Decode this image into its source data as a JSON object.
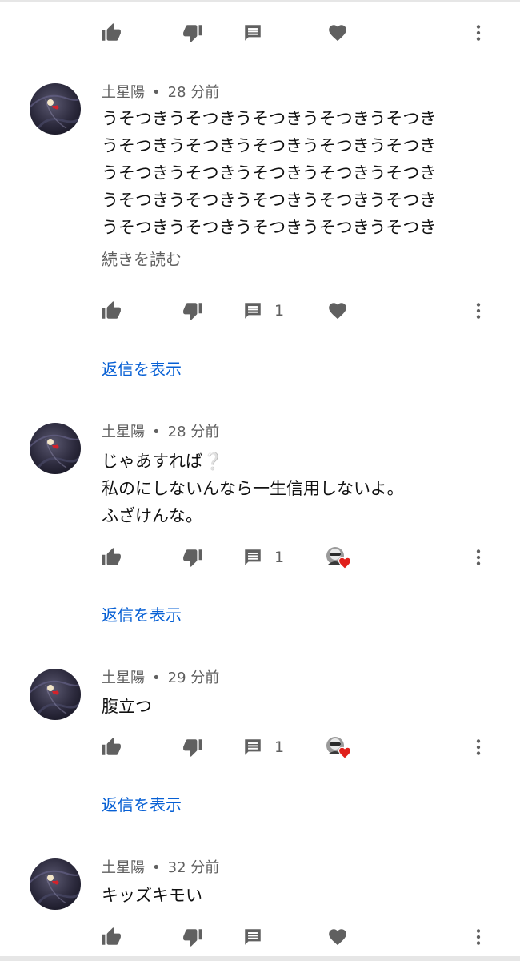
{
  "comments": [
    {
      "author": "土星陽",
      "separator": "•",
      "time": "28 分前",
      "text": "うそつきうそつきうそつきうそつきうそつき\nうそつきうそつきうそつきうそつきうそつき\nうそつきうそつきうそつきうそつきうそつき\nうそつきうそつきうそつきうそつきうそつき\nうそつきうそつきうそつきうそつきうそつき",
      "read_more": "続きを読む",
      "reply_count": "1",
      "view_replies": "返信を表示",
      "creator_heart": false
    },
    {
      "author": "土星陽",
      "separator": "•",
      "time": "28 分前",
      "text": "じゃあすれば❔\n私のにしないんなら一生信用しないよ。\nふざけんな。",
      "reply_count": "1",
      "view_replies": "返信を表示",
      "creator_heart": true
    },
    {
      "author": "土星陽",
      "separator": "•",
      "time": "29 分前",
      "text": "腹立つ",
      "reply_count": "1",
      "view_replies": "返信を表示",
      "creator_heart": true
    },
    {
      "author": "土星陽",
      "separator": "•",
      "time": "32 分前",
      "text": "キッズキモい",
      "creator_heart": false
    }
  ],
  "icons": {
    "like": "thumb-up-icon",
    "dislike": "thumb-down-icon",
    "reply": "comment-icon",
    "heart": "heart-icon",
    "more": "more-vert-icon",
    "icon_color": "#606060",
    "heart_color": "#e0201b",
    "link_color": "#065fd4"
  }
}
